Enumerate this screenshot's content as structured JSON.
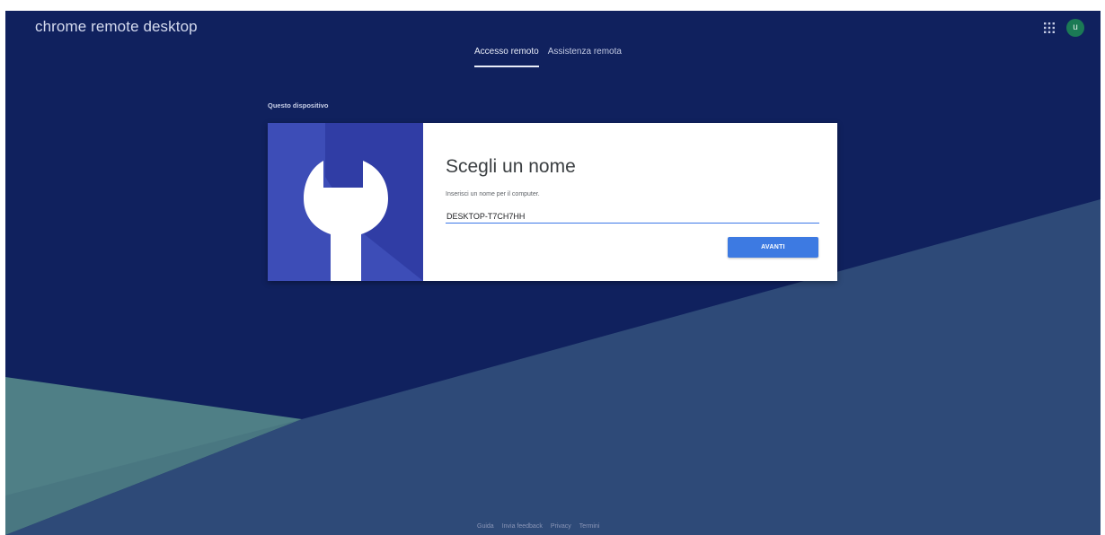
{
  "header": {
    "app_title": "chrome remote desktop",
    "apps_icon": "apps-grid-icon",
    "avatar_letter": "u"
  },
  "tabs": [
    {
      "label": "Accesso remoto",
      "active": true
    },
    {
      "label": "Assistenza remota",
      "active": false
    }
  ],
  "section": {
    "title": "Questo dispositivo"
  },
  "card": {
    "icon": "wrench-icon",
    "title": "Scegli un nome",
    "description": "Inserisci un nome per il computer.",
    "input_value": "DESKTOP-T7CH7HH",
    "next_label": "AVANTI"
  },
  "footer": {
    "links": [
      "Guida",
      "Invia feedback",
      "Privacy",
      "Termini"
    ]
  },
  "colors": {
    "background": "#10215e",
    "accent": "#3d7ae2",
    "avatar": "#1b7a55",
    "card_art": "#3d4db7"
  }
}
